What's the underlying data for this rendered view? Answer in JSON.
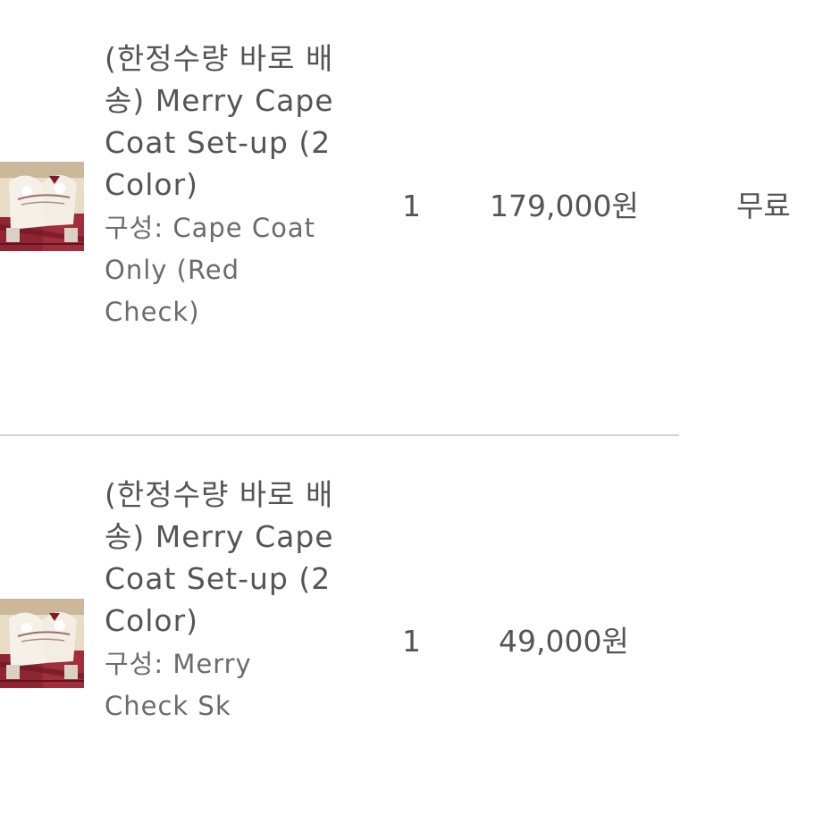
{
  "items": [
    {
      "thumbnail": "product-thumbnail",
      "name": "(한정수량 바로 배송) Merry Cape Coat Set-up (2 Color)",
      "option": "구성: Cape Coat Only (Red Check)",
      "quantity": "1",
      "price": "179,000원",
      "shipping": "무료"
    },
    {
      "thumbnail": "product-thumbnail",
      "name": "(한정수량 바로 배송) Merry Cape Coat Set-up (2 Color)",
      "option": "구성: Merry Check Sk",
      "quantity": "1",
      "price": "49,000원"
    }
  ],
  "colors": {
    "text": "#555555",
    "option_text": "#6b6b6b",
    "divider": "#d4d4d4",
    "thumbnail_red": "#8e2330",
    "thumbnail_cream": "#e9ddc8"
  }
}
